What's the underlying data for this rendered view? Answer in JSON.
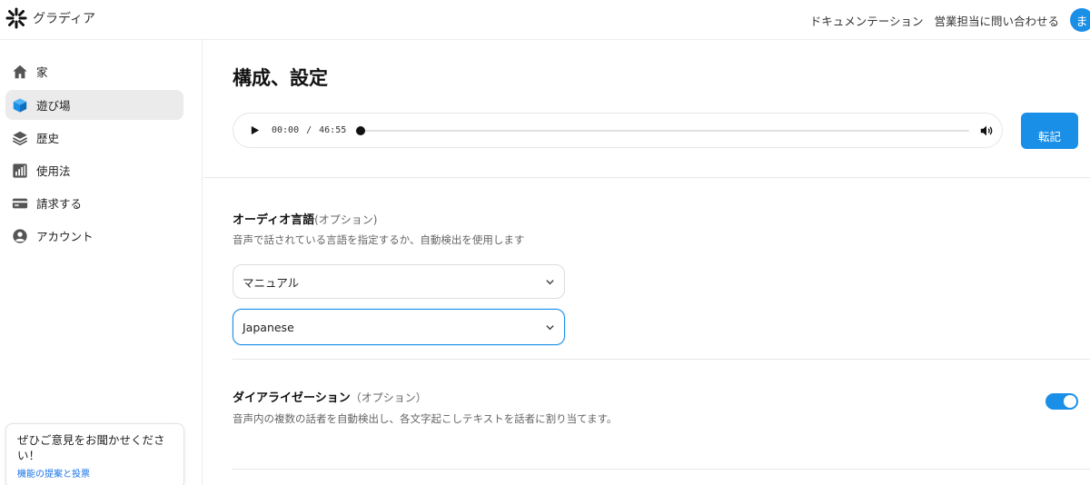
{
  "header": {
    "brand_name": "グラディア",
    "nav": [
      "ドキュメンテーション",
      "営業担当に問い合わせる"
    ],
    "avatar_initial": "ま"
  },
  "sidebar": {
    "items": [
      {
        "label": "家",
        "icon": "home-icon",
        "active": false
      },
      {
        "label": "遊び場",
        "icon": "cube-icon",
        "active": true
      },
      {
        "label": "歴史",
        "icon": "layers-icon",
        "active": false
      },
      {
        "label": "使用法",
        "icon": "bar-chart-icon",
        "active": false
      },
      {
        "label": "請求する",
        "icon": "credit-card-icon",
        "active": false
      },
      {
        "label": "アカウント",
        "icon": "user-circle-icon",
        "active": false
      }
    ],
    "feedback": {
      "text": "ぜひご意見をお聞かせください！",
      "link": "機能の提案と投票"
    }
  },
  "main": {
    "title": "構成、設定",
    "player": {
      "current_time": "00:00",
      "separator": "/",
      "duration": "46:55",
      "progress": 0
    },
    "transcribe_label": "転記",
    "audio_language": {
      "title": "オーディオ言語",
      "optional": "(オプション)",
      "description": "音声で話されている言語を指定するか、自動検出を使用します",
      "mode_value": "マニュアル",
      "language_value": "Japanese"
    },
    "diarization": {
      "title": "ダイアライゼーション",
      "optional": "（オプション）",
      "description": "音声内の複数の話者を自動検出し、各文字起こしテキストを話者に割り当てます。",
      "enabled": true
    }
  },
  "colors": {
    "accent": "#1a8fe8",
    "link": "#1a73e8",
    "active_bg": "#ebebeb"
  }
}
